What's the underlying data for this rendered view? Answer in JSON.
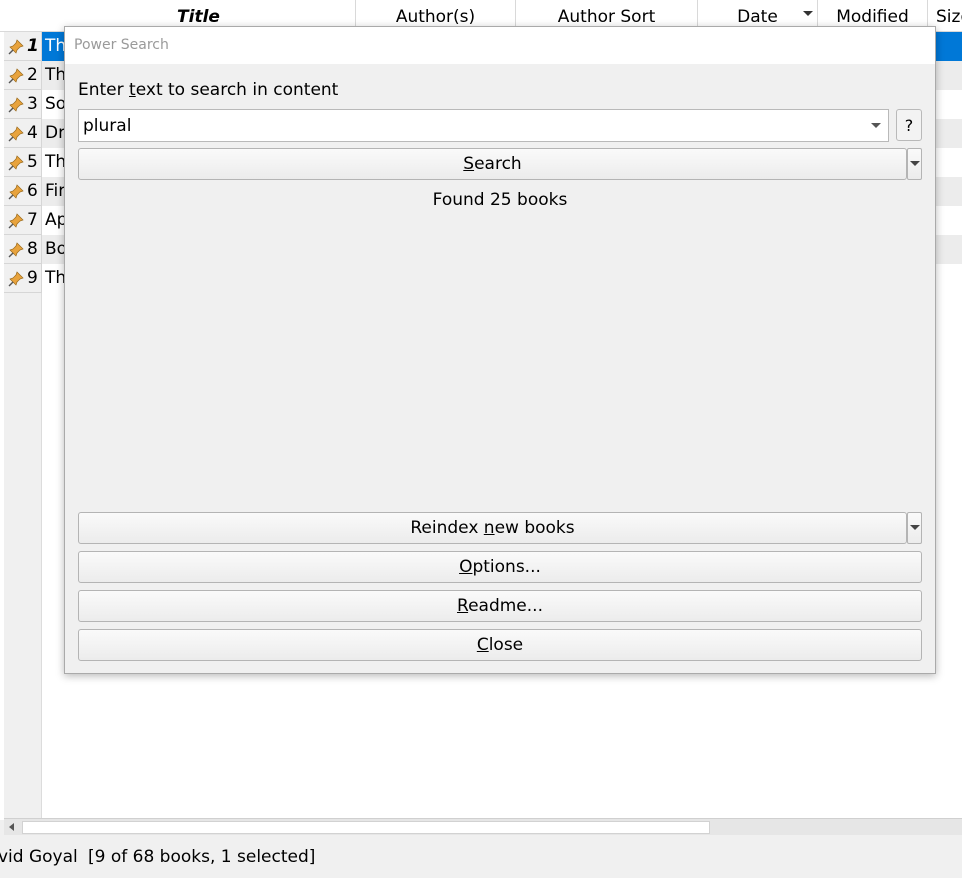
{
  "book_list": {
    "columns": [
      {
        "label": "Title",
        "sorted": true
      },
      {
        "label": "Author(s)"
      },
      {
        "label": "Author Sort"
      },
      {
        "label": "Date"
      },
      {
        "label": "Modified"
      },
      {
        "label": "Size"
      }
    ],
    "rows": [
      {
        "num": "1",
        "title": "Th"
      },
      {
        "num": "2",
        "title": "Th"
      },
      {
        "num": "3",
        "title": "So"
      },
      {
        "num": "4",
        "title": "Dr"
      },
      {
        "num": "5",
        "title": "Th"
      },
      {
        "num": "6",
        "title": "Fir"
      },
      {
        "num": "7",
        "title": "Ap"
      },
      {
        "num": "8",
        "title": "Bo"
      },
      {
        "num": "9",
        "title": "Th"
      }
    ],
    "selected_row": 1
  },
  "statusbar": {
    "author_fragment": "vid Goyal",
    "count_text": "[9 of 68 books, 1 selected]"
  },
  "dialog": {
    "title": "Power Search",
    "prompt": {
      "before": "Enter ",
      "underlined": "t",
      "after": "ext to search in content"
    },
    "search_value": "plural",
    "help_label": "?",
    "search_button": {
      "before": "",
      "underlined": "S",
      "after": "earch"
    },
    "result_text": "Found 25 books",
    "reindex_button": {
      "before": "Reindex ",
      "underlined": "n",
      "after": "ew books"
    },
    "options_button": {
      "before": "",
      "underlined": "O",
      "after": "ptions..."
    },
    "readme_button": {
      "before": "",
      "underlined": "R",
      "after": "eadme..."
    },
    "close_button": {
      "before": "",
      "underlined": "C",
      "after": "lose"
    }
  },
  "colors": {
    "selection": "#0078d7",
    "pin_icon": "#e8a33d"
  }
}
